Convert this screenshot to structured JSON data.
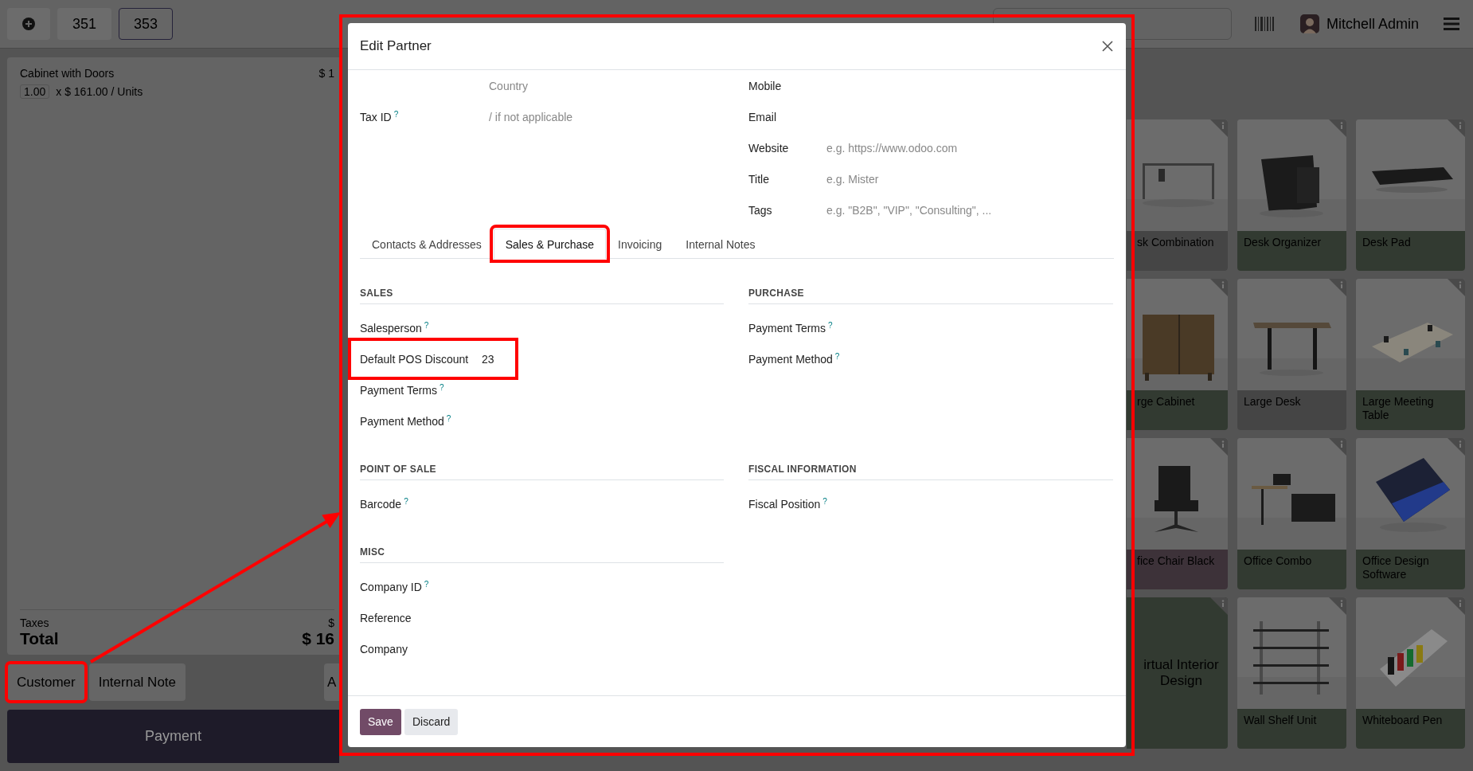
{
  "top_bar": {
    "orders": [
      {
        "label": "351",
        "selected": false
      },
      {
        "label": "353",
        "selected": true
      }
    ],
    "user": "Mitchell Admin"
  },
  "order": {
    "lines": [
      {
        "product": "Cabinet with Doors",
        "quantity": "1.00",
        "unit_price": "x $ 161.00 / Units",
        "price": "$ 1"
      }
    ],
    "taxes_label": "Taxes",
    "taxes_value": "$",
    "total_label": "Total",
    "total_value": "$ 16",
    "actions": [
      {
        "label": "Customer",
        "highlighted": true
      },
      {
        "label": "Internal Note",
        "highlighted": false
      },
      {
        "label": "A",
        "highlighted": false
      }
    ],
    "payment": "Payment"
  },
  "products": [
    {
      "name": "sk Combination",
      "color": "#454545",
      "kind": "picture"
    },
    {
      "name": "Desk Organizer",
      "color": "#323a31",
      "kind": "picture"
    },
    {
      "name": "Desk Pad",
      "color": "#323a31",
      "kind": "picture"
    },
    {
      "name": "rge Cabinet",
      "color": "#323a31",
      "kind": "picture"
    },
    {
      "name": "Large Desk",
      "color": "#454545",
      "kind": "picture"
    },
    {
      "name": "Large Meeting Table",
      "color": "#323a31",
      "kind": "picture"
    },
    {
      "name": "fice Chair Black",
      "color": "#3d3239",
      "kind": "picture"
    },
    {
      "name": "Office Combo",
      "color": "#323a31",
      "kind": "picture"
    },
    {
      "name": "Office Design Software",
      "color": "#323a31",
      "kind": "picture"
    },
    {
      "name": "irtual Interior Design",
      "color": "#323a31",
      "kind": "service"
    },
    {
      "name": "Wall Shelf Unit",
      "color": "#323a31",
      "kind": "picture"
    },
    {
      "name": "Whiteboard Pen",
      "color": "#323a31",
      "kind": "picture"
    }
  ],
  "dialog": {
    "title": "Edit Partner",
    "highlighted": true,
    "top_left": [
      {
        "placeholder": "Country"
      },
      {
        "label": "Tax ID",
        "help": "?",
        "placeholder": "/ if not applicable"
      }
    ],
    "top_right": [
      {
        "label": "Mobile"
      },
      {
        "label": "Email"
      },
      {
        "label": "Website",
        "placeholder": "e.g. https://www.odoo.com"
      },
      {
        "label": "Title",
        "placeholder": "e.g. Mister"
      },
      {
        "label": "Tags",
        "placeholder": "e.g. \"B2B\", \"VIP\", \"Consulting\", ..."
      }
    ],
    "tabs": [
      {
        "label": "Contacts & Addresses",
        "selected": false,
        "highlighted": false
      },
      {
        "label": "Sales & Purchase",
        "selected": true,
        "highlighted": true
      },
      {
        "label": "Invoicing",
        "selected": false,
        "highlighted": false
      },
      {
        "label": "Internal Notes",
        "selected": false,
        "highlighted": false
      }
    ],
    "section_rows": [
      [
        {
          "title": "SALES",
          "fields": [
            {
              "label": "Salesperson",
              "help": "?",
              "highlighted": false
            },
            {
              "label": "Default POS Discount",
              "value": "23",
              "highlighted": true
            },
            {
              "label": "Payment Terms",
              "help": "?",
              "highlighted": false
            },
            {
              "label": "Payment Method",
              "help": "?",
              "highlighted": false
            }
          ]
        },
        {
          "title": "PURCHASE",
          "fields": [
            {
              "label": "Payment Terms",
              "help": "?",
              "highlighted": false
            },
            {
              "label": "Payment Method",
              "help": "?",
              "highlighted": false
            }
          ]
        }
      ],
      [
        {
          "title": "POINT OF SALE",
          "fields": [
            {
              "label": "Barcode",
              "help": "?",
              "highlighted": false
            }
          ]
        },
        {
          "title": "FISCAL INFORMATION",
          "fields": [
            {
              "label": "Fiscal Position",
              "help": "?",
              "highlighted": false
            }
          ]
        }
      ],
      [
        {
          "title": "MISC",
          "fields": [
            {
              "label": "Company ID",
              "help": "?",
              "highlighted": false
            },
            {
              "label": "Reference",
              "highlighted": false
            },
            {
              "label": "Company",
              "highlighted": false
            }
          ]
        }
      ]
    ],
    "buttons": [
      {
        "label": "Save",
        "kind": "primary"
      },
      {
        "label": "Discard",
        "kind": "secondary"
      }
    ]
  },
  "annotation_arrow": true
}
